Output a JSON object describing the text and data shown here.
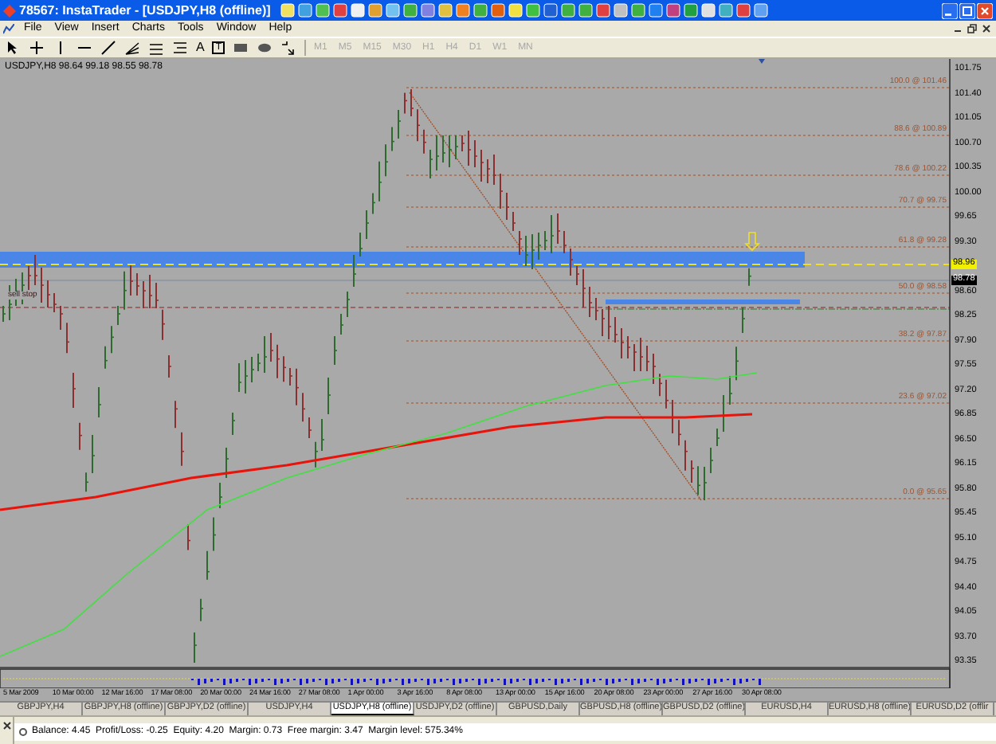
{
  "window": {
    "title": "78567: InstaTrader - [USDJPY,H8 (offline)]"
  },
  "menu": [
    "File",
    "View",
    "Insert",
    "Charts",
    "Tools",
    "Window",
    "Help"
  ],
  "tools": [
    {
      "kind": "cursor"
    },
    {
      "kind": "crosshair"
    },
    {
      "kind": "vline"
    },
    {
      "kind": "hline"
    },
    {
      "kind": "trend"
    },
    {
      "kind": "fan"
    },
    {
      "kind": "channel"
    },
    {
      "kind": "fibo"
    },
    {
      "kind": "glyph",
      "text": "A"
    },
    {
      "kind": "boxglyph",
      "text": "T"
    },
    {
      "kind": "rect"
    },
    {
      "kind": "ellipse"
    },
    {
      "kind": "arrows"
    }
  ],
  "timeframes": [
    {
      "label": "M1",
      "disabled": true
    },
    {
      "label": "M5",
      "disabled": true
    },
    {
      "label": "M15",
      "disabled": true
    },
    {
      "label": "M30",
      "disabled": true
    },
    {
      "label": "H1",
      "disabled": true
    },
    {
      "label": "H4",
      "disabled": true
    },
    {
      "label": "D1",
      "disabled": true
    },
    {
      "label": "W1",
      "disabled": true
    },
    {
      "label": "MN",
      "disabled": true
    }
  ],
  "chart": {
    "header": "USDJPY,H8  98.64 99.18 98.55 98.78",
    "order_label": "sell stop",
    "fib_labels": [
      "100.0 @ 101.46",
      "88.6 @ 100.89",
      "78.6 @ 100.22",
      "70.7 @ 99.75",
      "61.8 @ 99.28",
      "50.0 @ 98.58",
      "38.2 @ 97.87",
      "23.6 @ 97.02",
      "0.0 @ 95.65"
    ],
    "price_ticks_upper": [
      "101.75",
      "101.40",
      "101.05",
      "100.70",
      "100.35",
      "100.00",
      "99.65",
      "99.30"
    ],
    "price_ticks_lower": [
      "98.60",
      "98.25",
      "97.90",
      "97.55",
      "97.20",
      "96.85",
      "96.50",
      "96.15",
      "95.80",
      "95.45",
      "95.10",
      "94.75",
      "94.40",
      "94.05",
      "93.70",
      "93.35"
    ],
    "price_markers": [
      {
        "kind": "alert",
        "label": "98.96"
      },
      {
        "kind": "bid",
        "label": "98.78"
      }
    ],
    "time_axis": [
      "5 Mar 2009",
      "10 Mar 00:00",
      "12 Mar 16:00",
      "17 Mar 08:00",
      "20 Mar 00:00",
      "24 Mar 16:00",
      "27 Mar 08:00",
      "1 Apr 00:00",
      "3 Apr 16:00",
      "8 Apr 08:00",
      "13 Apr 00:00",
      "15 Apr 16:00",
      "20 Apr 08:00",
      "23 Apr 00:00",
      "27 Apr 16:00",
      "30 Apr 08:00"
    ]
  },
  "tabs": [
    {
      "label": "GBPJPY,H4",
      "selected": false
    },
    {
      "label": "GBPJPY,H8 (offline)",
      "selected": false
    },
    {
      "label": "GBPJPY,D2 (offline)",
      "selected": false
    },
    {
      "label": "USDJPY,H4",
      "selected": false
    },
    {
      "label": "USDJPY,H8 (offline)",
      "selected": true
    },
    {
      "label": "USDJPY,D2 (offline)",
      "selected": false
    },
    {
      "label": "GBPUSD,Daily",
      "selected": false
    },
    {
      "label": "GBPUSD,H8 (offline)",
      "selected": false
    },
    {
      "label": "GBPUSD,D2 (offline)",
      "selected": false
    },
    {
      "label": "EURUSD,H4",
      "selected": false
    },
    {
      "label": "EURUSD,H8 (offline)",
      "selected": false
    },
    {
      "label": "EURUSD,D2 (offlir",
      "selected": false
    }
  ],
  "status_bar": {
    "text": "Balance: 4.45  Profit/Loss: -0.25  Equity: 4.20  Margin: 0.73  Free margin: 3.47  Margin level: 575.34%"
  }
}
